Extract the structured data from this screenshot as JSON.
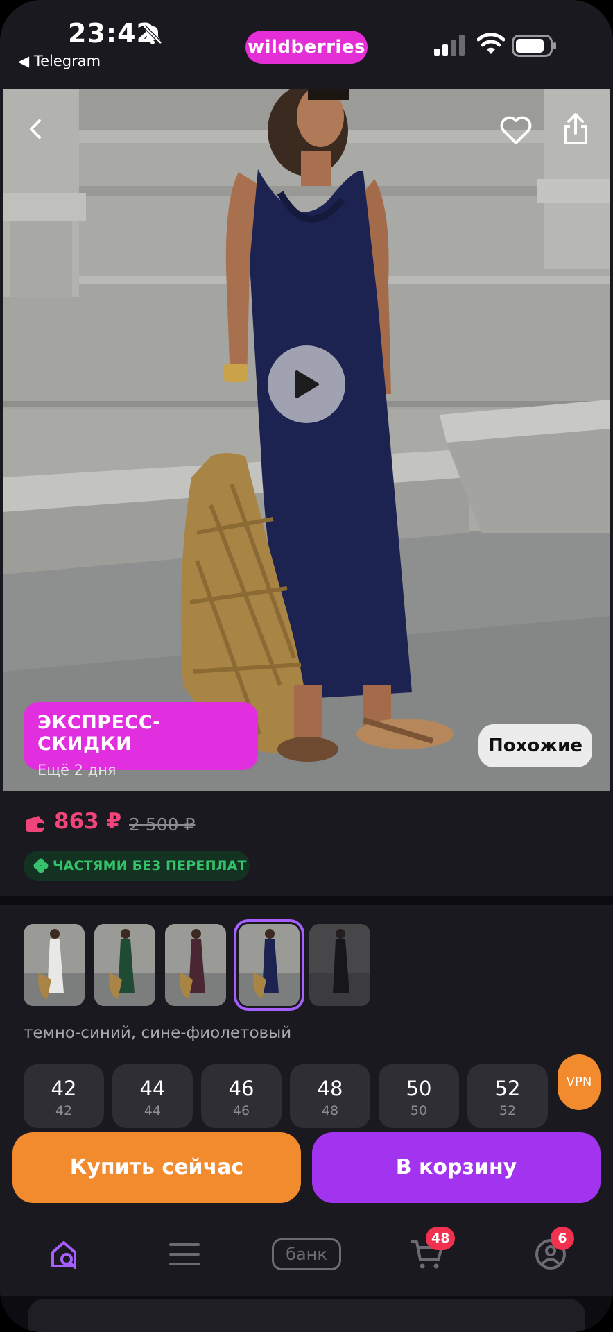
{
  "status_bar": {
    "time": "23:42",
    "back_app": "◀ Telegram",
    "brand": "wildberries",
    "brand_color": "#e42fd6"
  },
  "hero": {
    "icons": [
      "back-arrow-icon",
      "heart-icon",
      "share-icon",
      "play-icon"
    ],
    "promo_title": "ЭКСПРЕСС-СКИДКИ",
    "promo_subtitle": "Ещё 2 дня",
    "similar_label": "Похожие"
  },
  "price": {
    "current": "863 ₽",
    "old": "2 500 ₽",
    "installments": "ЧАСТЯМИ БЕЗ ПЕРЕПЛАТ",
    "current_color": "#f0457a"
  },
  "variants": {
    "color_label": "темно-синий, сине-фиолетовый",
    "thumbnails": [
      {
        "dress": "#e8e8e6",
        "state": "normal"
      },
      {
        "dress": "#1f4a33",
        "state": "normal"
      },
      {
        "dress": "#4a2633",
        "state": "normal"
      },
      {
        "dress": "#1c2350",
        "state": "selected"
      },
      {
        "dress": "#141414",
        "state": "dimmed"
      }
    ],
    "sizes": [
      {
        "size": "42",
        "ru": "42"
      },
      {
        "size": "44",
        "ru": "44"
      },
      {
        "size": "46",
        "ru": "46"
      },
      {
        "size": "48",
        "ru": "48"
      },
      {
        "size": "50",
        "ru": "50"
      },
      {
        "size": "52",
        "ru": "52"
      }
    ]
  },
  "vpn_label": "VPN",
  "actions": {
    "buy_now": "Купить сейчас",
    "add_to_cart": "В корзину",
    "buy_color": "#f28a2e",
    "cart_color": "#a234f0"
  },
  "tabbar": {
    "items": [
      "home-search-icon",
      "menu-icon",
      "bank-icon",
      "cart-icon",
      "profile-icon"
    ],
    "bank_label": "банк",
    "cart_badge": "48",
    "profile_badge": "6",
    "active_color": "#a660ff"
  }
}
